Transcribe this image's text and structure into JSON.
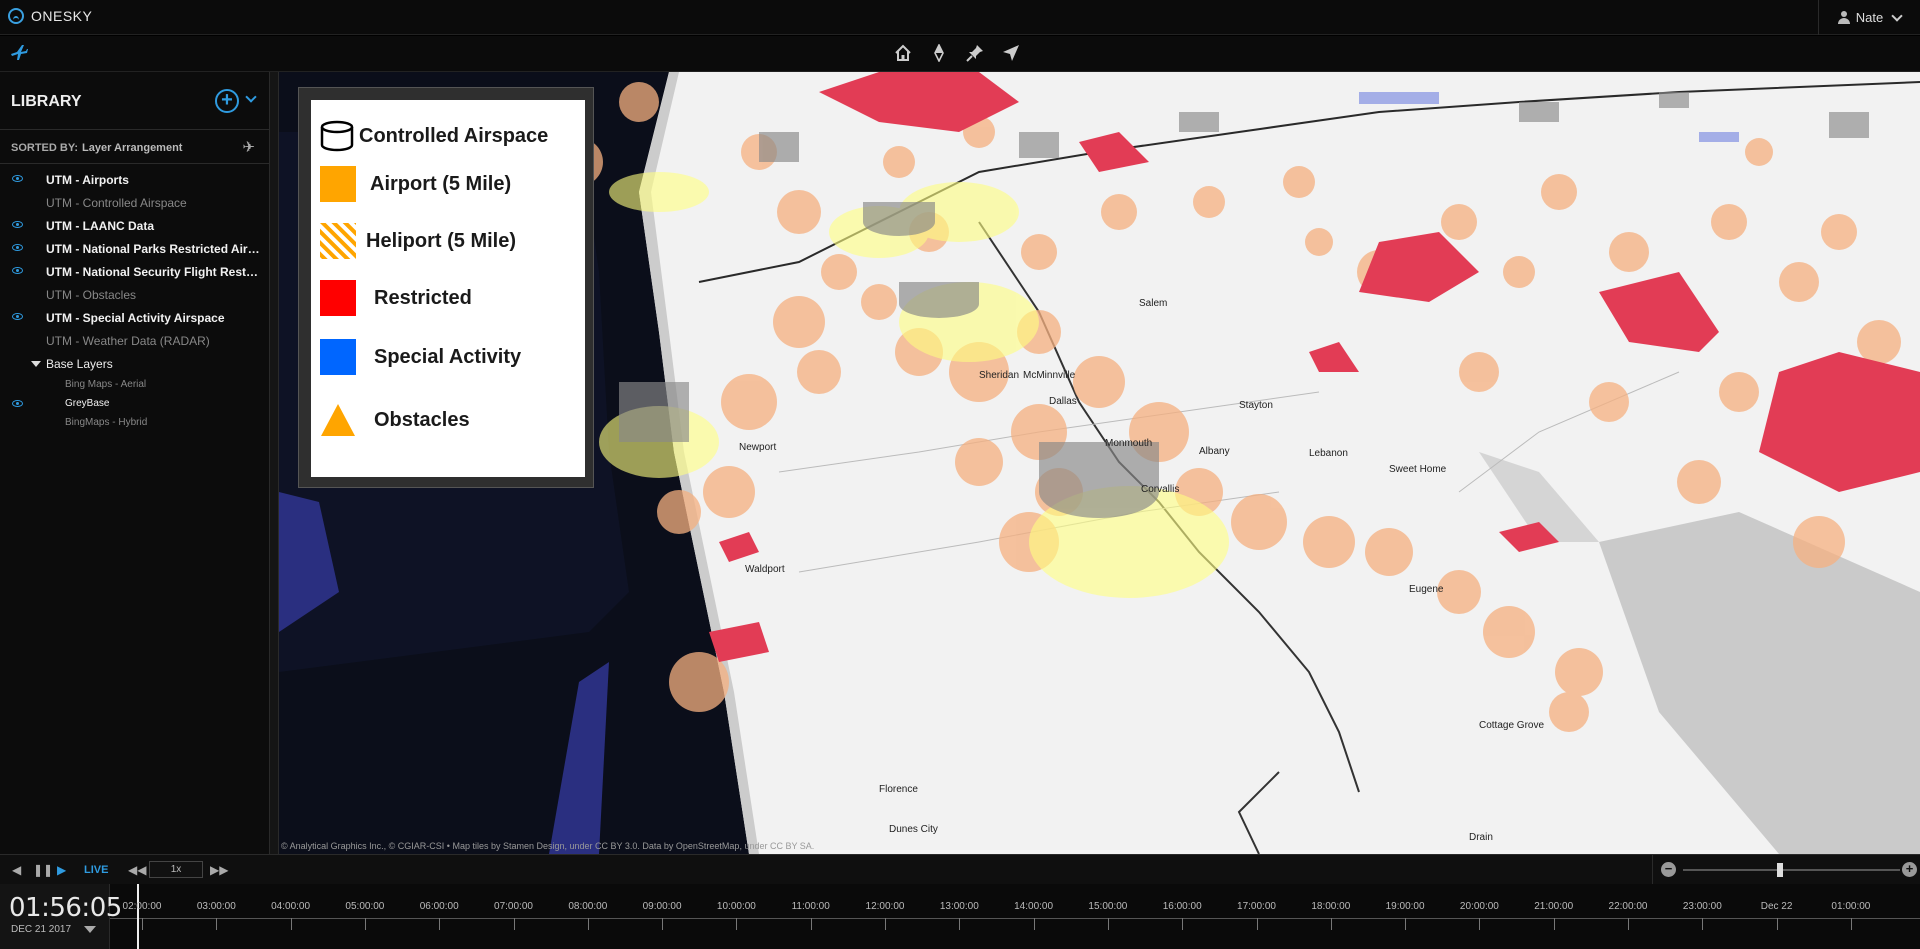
{
  "app": {
    "name": "ONESKY"
  },
  "user": {
    "name": "Nate"
  },
  "toolbar": {
    "tools": [
      "home-icon",
      "compass-icon",
      "pin-icon",
      "navigate-icon"
    ]
  },
  "library": {
    "title": "LIBRARY",
    "sorted_by_label": "SORTED BY:",
    "sorted_by_value": "Layer Arrangement",
    "layers": [
      {
        "label": "UTM - Airports",
        "visible": true
      },
      {
        "label": "UTM - Controlled Airspace",
        "visible": false
      },
      {
        "label": "UTM - LAANC Data",
        "visible": true
      },
      {
        "label": "UTM - National Parks Restricted Airspace",
        "visible": true
      },
      {
        "label": "UTM - National Security Flight Restrictions",
        "visible": true
      },
      {
        "label": "UTM - Obstacles",
        "visible": false
      },
      {
        "label": "UTM - Special Activity Airspace",
        "visible": true
      },
      {
        "label": "UTM - Weather Data (RADAR)",
        "visible": false
      }
    ],
    "group": {
      "label": "Base Layers",
      "items": [
        {
          "label": "Bing Maps - Aerial",
          "visible": false
        },
        {
          "label": "GreyBase",
          "visible": true
        },
        {
          "label": "BingMaps - Hybrid",
          "visible": false
        }
      ]
    }
  },
  "legend": {
    "items": [
      {
        "label": "Controlled Airspace",
        "symbol": "cylinder",
        "color": "#000000"
      },
      {
        "label": "Airport (5 Mile)",
        "symbol": "square",
        "color": "#FFA500"
      },
      {
        "label": "Heliport (5 Mile)",
        "symbol": "hatched-square",
        "color": "#FFA500"
      },
      {
        "label": "Restricted",
        "symbol": "square",
        "color": "#FF0000"
      },
      {
        "label": "Special Activity",
        "symbol": "square",
        "color": "#0066FF"
      },
      {
        "label": "Obstacles",
        "symbol": "triangle",
        "color": "#FFA500"
      }
    ]
  },
  "map": {
    "attribution": "© Analytical Graphics Inc., © CGIAR-CSI • Map tiles by Stamen Design, under CC BY 3.0. Data by OpenStreetMap, under CC BY SA.",
    "place_labels": [
      "Dallas",
      "Monmouth",
      "McMinnville",
      "Sheridan",
      "Albany",
      "Lebanon",
      "Corvallis",
      "Sweet Home",
      "Eugene",
      "Florence",
      "Salem",
      "Stayton",
      "Newport",
      "Waldport",
      "Dunes City",
      "Drain",
      "Cottage Grove"
    ]
  },
  "playback": {
    "live_label": "LIVE",
    "speed": "1x"
  },
  "clock": {
    "time": "01:56:05",
    "date": "DEC 21 2017"
  },
  "timeline": {
    "ticks": [
      "02:00:00",
      "03:00:00",
      "04:00:00",
      "05:00:00",
      "06:00:00",
      "07:00:00",
      "08:00:00",
      "09:00:00",
      "10:00:00",
      "11:00:00",
      "12:00:00",
      "13:00:00",
      "14:00:00",
      "15:00:00",
      "16:00:00",
      "17:00:00",
      "18:00:00",
      "19:00:00",
      "20:00:00",
      "21:00:00",
      "22:00:00",
      "23:00:00",
      "Dec 22",
      "01:00:00"
    ]
  }
}
